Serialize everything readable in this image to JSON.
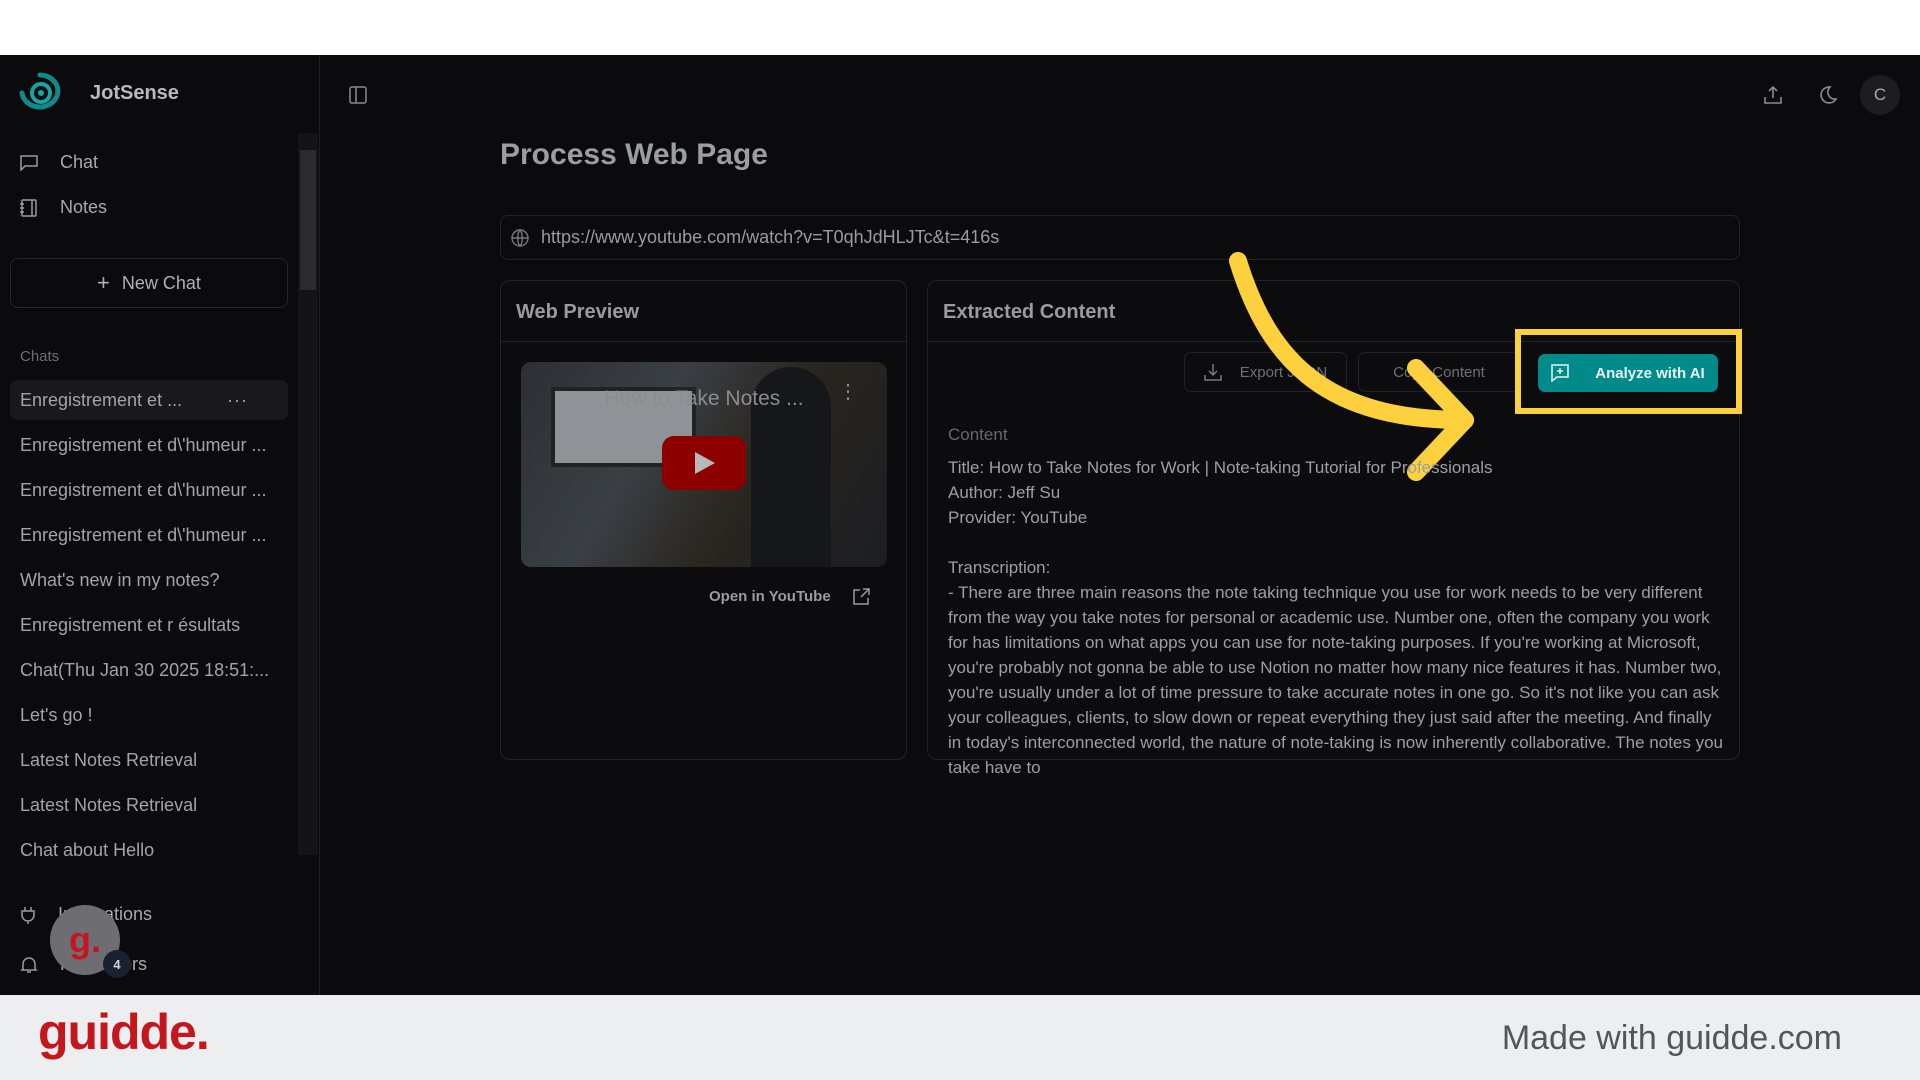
{
  "app": {
    "name": "JotSense",
    "accent": "#008a8a"
  },
  "sidebar": {
    "nav": [
      {
        "label": "Chat",
        "icon": "message-square-icon"
      },
      {
        "label": "Notes",
        "icon": "notebook-icon"
      }
    ],
    "new_chat": "New Chat",
    "chats_label": "Chats",
    "chats": [
      "Enregistrement et ...",
      "Enregistrement et d\\'humeur ...",
      "Enregistrement et d\\'humeur ...",
      "Enregistrement et d\\'humeur ...",
      "What's new in my notes?",
      "Enregistrement et r ésultats",
      "Chat(Thu Jan 30 2025 18:51:...",
      "Let's go !",
      "Latest Notes Retrieval",
      "Latest Notes Retrieval",
      "Chat about Hello"
    ],
    "bottom": [
      {
        "label": "Integrations",
        "icon": "plug-icon"
      },
      {
        "label": "Reminders",
        "icon": "bell-icon"
      }
    ],
    "badge": "4"
  },
  "header": {
    "avatar": "C"
  },
  "main": {
    "title": "Process Web Page",
    "url": "https://www.youtube.com/watch?v=T0qhJdHLJTc&t=416s",
    "preview": {
      "title": "Web Preview",
      "video_title": "How to Take Notes ...",
      "open_link": "Open in YouTube"
    },
    "extracted": {
      "title": "Extracted Content",
      "export_json": "Export JSON",
      "copy_content": "Copy Content",
      "analyze": "Analyze with AI",
      "content_label": "Content",
      "content": "Title: How to Take Notes for Work | Note-taking Tutorial for Professionals\nAuthor: Jeff Su\nProvider: YouTube\n\nTranscription:\n- There are three main reasons the note taking technique you use for work needs to be very different from the way you take notes for personal or academic use. Number one, often the company you work for has limitations on what apps you can use for note-taking purposes. If you're working at Microsoft, you're probably not gonna be able to use Notion no matter how many nice features it has. Number two, you're usually under a lot of time pressure to take accurate notes in one go. So it's not like you can ask your colleagues, clients, to slow down or repeat everything they just said after the meeting. And finally in today's interconnected world, the nature of note-taking is now inherently collaborative. The notes you take have to"
    }
  },
  "footer": {
    "logo": "guidde.",
    "made_with": "Made with guidde.com"
  }
}
